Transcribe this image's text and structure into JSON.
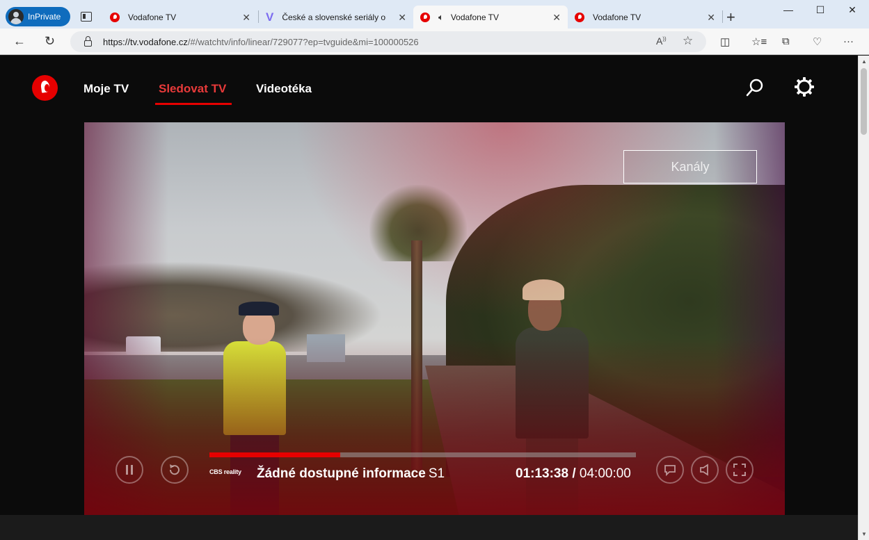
{
  "browser": {
    "inprivate_label": "InPrivate",
    "tabs": [
      {
        "title": "Vodafone TV",
        "favicon": "vodafone-icon"
      },
      {
        "title": "České a slovenské seriály online",
        "favicon": "v-icon"
      },
      {
        "title": "Vodafone TV",
        "favicon": "vodafone-icon",
        "active": true,
        "audio": true
      },
      {
        "title": "Vodafone TV",
        "favicon": "vodafone-icon"
      }
    ],
    "url_host": "https://tv.vodafone.cz",
    "url_path": "/#/watchtv/info/linear/729077?ep=tvguide&mi=100000526"
  },
  "nav": {
    "items": [
      "Moje TV",
      "Sledovat TV",
      "Videotéka"
    ],
    "active_index": 1
  },
  "player": {
    "channels_label": "Kanály",
    "channel_logo": "CBS reality",
    "program_title": "Žádné dostupné informace",
    "season": "S1",
    "current_time": "01:13:38",
    "separator": "/",
    "total_time": "04:00:00",
    "progress_fraction": 0.307
  },
  "colors": {
    "accent": "#e60000",
    "background": "#0b0b0b"
  }
}
